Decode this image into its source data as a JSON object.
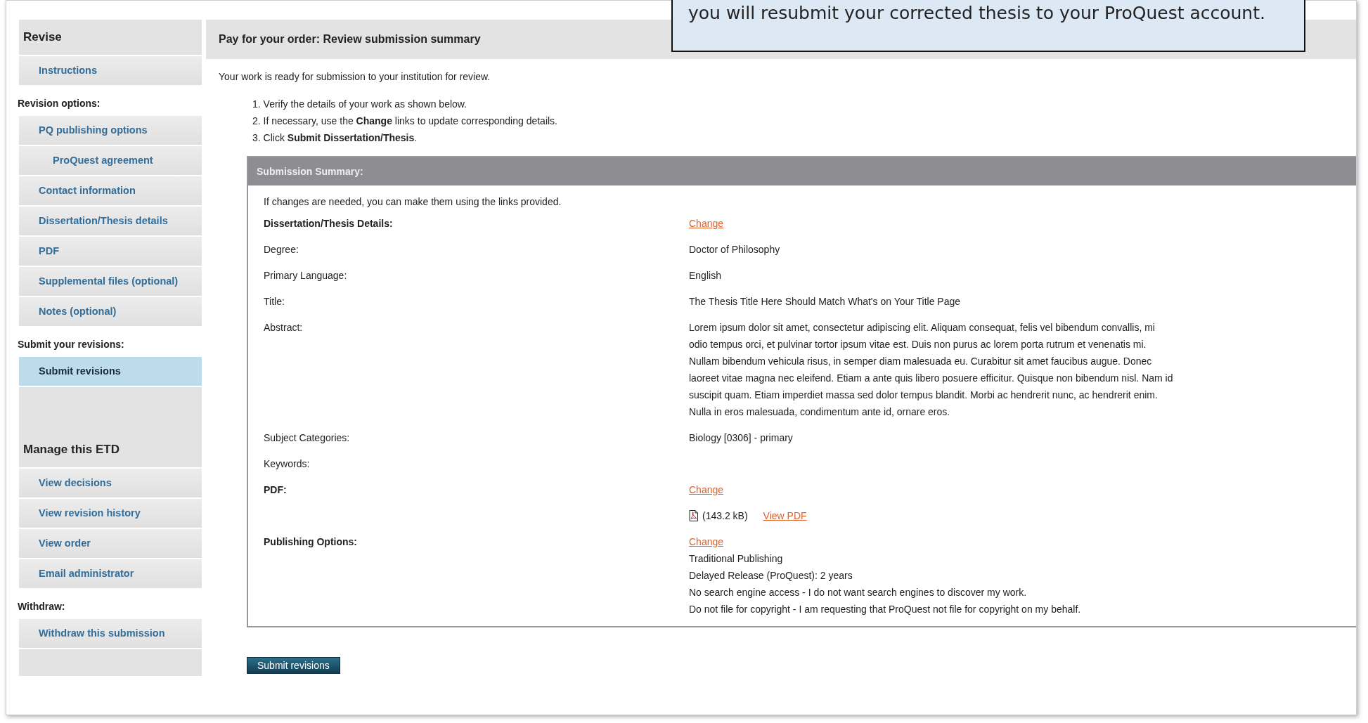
{
  "callout": {
    "text": "you will resubmit your corrected thesis to your ProQuest account."
  },
  "sidebar": {
    "groups": [
      {
        "title": "Revise",
        "sections": [
          {
            "items": [
              {
                "label": "Instructions",
                "selected": false
              }
            ]
          },
          {
            "heading": "Revision options:",
            "items": [
              {
                "label": "PQ publishing options",
                "selected": false,
                "children": [
                  {
                    "label": "ProQuest agreement",
                    "selected": false
                  }
                ]
              },
              {
                "label": "Contact information",
                "selected": false
              },
              {
                "label": "Dissertation/Thesis details",
                "selected": false
              },
              {
                "label": "PDF",
                "selected": false
              },
              {
                "label": "Supplemental files (optional)",
                "selected": false
              },
              {
                "label": "Notes (optional)",
                "selected": false
              }
            ]
          },
          {
            "heading": "Submit your revisions:",
            "items": [
              {
                "label": "Submit revisions",
                "selected": true
              }
            ]
          }
        ]
      },
      {
        "title": "Manage this ETD",
        "sections": [
          {
            "items": [
              {
                "label": "View decisions",
                "selected": false
              },
              {
                "label": "View revision history",
                "selected": false
              },
              {
                "label": "View order",
                "selected": false
              },
              {
                "label": "Email administrator",
                "selected": false
              }
            ]
          },
          {
            "heading": "Withdraw:",
            "items": [
              {
                "label": "Withdraw this submission",
                "selected": false
              }
            ]
          }
        ]
      }
    ]
  },
  "main": {
    "title": "Pay for your order: Review submission summary",
    "intro": "Your work is ready for submission to your institution for review.",
    "steps": [
      "1. Verify the details of your work as shown below.",
      "2. If necessary, use the **Change** links to update corresponding details.",
      "3. Click **Submit Dissertation/Thesis**."
    ],
    "summary": {
      "title": "Submission Summary:",
      "note": "If changes are needed, you can make them using the links provided.",
      "rows": [
        {
          "kind": "section",
          "label": "Dissertation/Thesis Details:",
          "link": "Change"
        },
        {
          "kind": "field",
          "label": "Degree:",
          "value": "Doctor of Philosophy"
        },
        {
          "kind": "field",
          "label": "Primary Language:",
          "value": "English"
        },
        {
          "kind": "field",
          "label": "Title:",
          "value": "The Thesis Title Here Should Match What's on Your Title Page"
        },
        {
          "kind": "field",
          "label": "Abstract:",
          "value": "Lorem ipsum dolor sit amet, consectetur adipiscing elit. Aliquam consequat, felis vel bibendum convallis, mi odio tempus orci, et pulvinar tortor ipsum vitae est. Duis non purus ac lorem porta rutrum et venenatis mi. Nullam bibendum vehicula risus, in semper diam malesuada eu. Curabitur sit amet faucibus augue. Donec laoreet vitae magna nec eleifend. Etiam a ante quis libero posuere efficitur. Quisque non bibendum nisl. Nam id suscipit quam. Etiam imperdiet massa sed dolor tempus blandit. Morbi ac hendrerit nunc, ac hendrerit enim. Nulla in eros malesuada, condimentum ante id, ornare eros."
        },
        {
          "kind": "field",
          "label": "Subject Categories:",
          "value": "Biology [0306] - primary"
        },
        {
          "kind": "field",
          "label": "Keywords:"
        },
        {
          "kind": "section",
          "label": "PDF:",
          "link": "Change"
        },
        {
          "kind": "file",
          "size": "(143.2 kB)",
          "link": "View PDF"
        },
        {
          "kind": "section",
          "label": "Publishing Options:",
          "link": "Change",
          "lines": [
            "Traditional Publishing",
            "Delayed Release (ProQuest): 2 years",
            "No search engine access - I do not want search engines to discover my work.",
            "Do not file for copyright - I am requesting that ProQuest not file for copyright on my behalf."
          ]
        }
      ]
    },
    "submit_button": "Submit revisions"
  }
}
